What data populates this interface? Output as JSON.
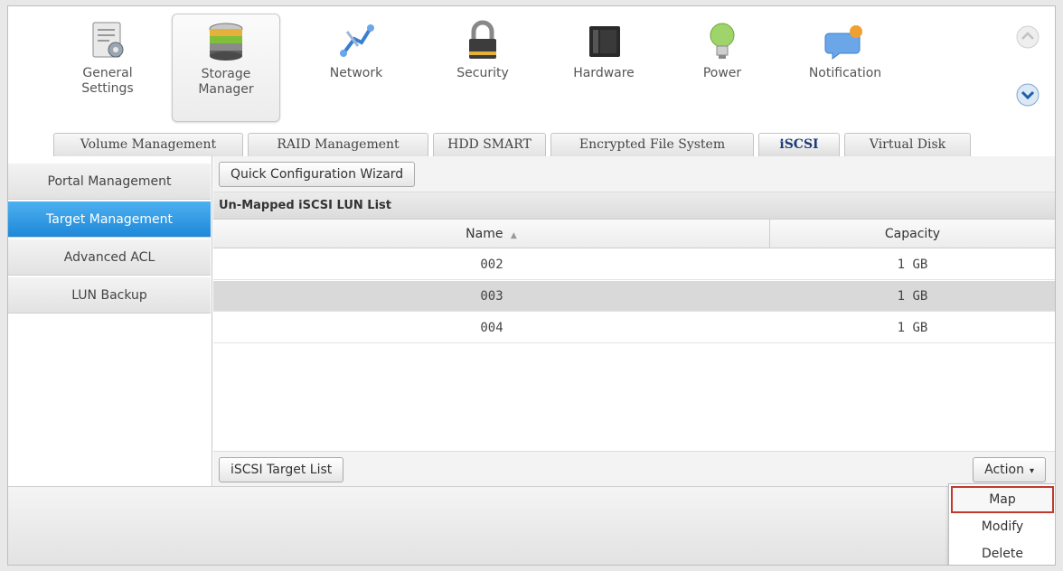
{
  "top_nav": {
    "items": [
      {
        "label_line1": "General",
        "label_line2": "Settings",
        "icon": "general-settings-icon"
      },
      {
        "label_line1": "Storage",
        "label_line2": "Manager",
        "icon": "storage-manager-icon",
        "active": true
      },
      {
        "label_line1": "Network",
        "label_line2": "",
        "icon": "network-icon"
      },
      {
        "label_line1": "Security",
        "label_line2": "",
        "icon": "lock-icon"
      },
      {
        "label_line1": "Hardware",
        "label_line2": "",
        "icon": "hardware-icon"
      },
      {
        "label_line1": "Power",
        "label_line2": "",
        "icon": "power-bulb-icon"
      },
      {
        "label_line1": "Notification",
        "label_line2": "",
        "icon": "notification-icon"
      }
    ],
    "scroll_up_icon": "chevron-up-icon",
    "scroll_down_icon": "chevron-down-icon"
  },
  "tabs": [
    {
      "label": "Volume Management"
    },
    {
      "label": "RAID Management"
    },
    {
      "label": "HDD SMART"
    },
    {
      "label": "Encrypted File System"
    },
    {
      "label": "iSCSI",
      "active": true
    },
    {
      "label": "Virtual Disk"
    }
  ],
  "sidebar": {
    "items": [
      {
        "label": "Portal Management"
      },
      {
        "label": "Target Management",
        "active": true
      },
      {
        "label": "Advanced ACL"
      },
      {
        "label": "LUN Backup"
      }
    ]
  },
  "main": {
    "wizard_button": "Quick Configuration Wizard",
    "list_title": "Un-Mapped iSCSI LUN List",
    "columns": {
      "name": "Name",
      "sort_indicator": "▲",
      "capacity": "Capacity"
    },
    "rows": [
      {
        "name": "002",
        "capacity": "1 GB"
      },
      {
        "name": "003",
        "capacity": "1 GB",
        "selected": true
      },
      {
        "name": "004",
        "capacity": "1 GB"
      }
    ],
    "target_list_button": "iSCSI Target List",
    "action_button": "Action",
    "action_caret": "▾"
  },
  "action_menu": {
    "items": [
      {
        "label": "Map",
        "highlighted": true
      },
      {
        "label": "Modify"
      },
      {
        "label": "Delete"
      }
    ]
  },
  "colors": {
    "active_sidebar": "#1e88d8",
    "active_tab_text": "#1e3c78",
    "highlight_border": "#c0392b"
  }
}
